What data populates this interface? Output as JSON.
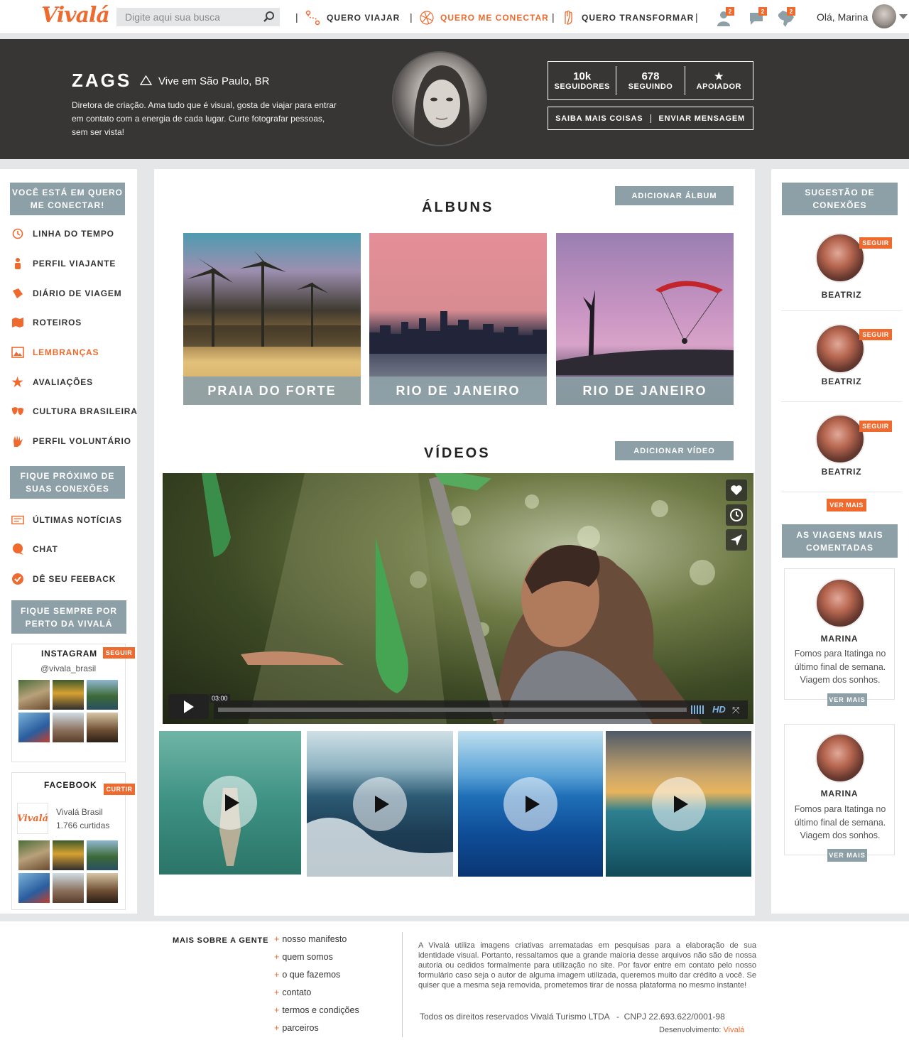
{
  "nav": {
    "logo": "Vivalá",
    "search_placeholder": "Digite aqui sua busca",
    "items": [
      {
        "label": "QUERO VIAJAR"
      },
      {
        "label": "QUERO ME CONECTAR"
      },
      {
        "label": "QUERO TRANSFORMAR"
      }
    ],
    "separator": "|",
    "badges": [
      "2",
      "2",
      "2"
    ],
    "greeting": "Olá, Marina"
  },
  "profile": {
    "name": "ZAGS",
    "location": "Vive em São Paulo, BR",
    "bio": "Diretora de criação. Ama tudo que é visual, gosta de viajar para entrar em contato com a energia de cada lugar. Curte fotografar pessoas, sem ser vista!",
    "stats": [
      {
        "value": "10k",
        "label": "SEGUIDORES"
      },
      {
        "value": "678",
        "label": "SEGUINDO"
      },
      {
        "value": "★",
        "label": "APOIADOR"
      }
    ],
    "actions": [
      "SAIBA MAIS COISAS",
      "ENVIAR MENSAGEM"
    ]
  },
  "left": {
    "box1": "VOCÊ ESTÁ EM QUERO ME CONECTAR!",
    "menu": [
      {
        "label": "LINHA DO TEMPO",
        "icon": "clock-icon"
      },
      {
        "label": "PERFIL VIAJANTE",
        "icon": "person-icon"
      },
      {
        "label": "DIÁRIO DE VIAGEM",
        "icon": "book-icon"
      },
      {
        "label": "ROTEIROS",
        "icon": "map-icon"
      },
      {
        "label": "LEMBRANÇAS",
        "icon": "photo-icon",
        "active": true
      },
      {
        "label": "AVALIAÇÕES",
        "icon": "star-icon"
      },
      {
        "label": "CULTURA BRASILEIRA",
        "icon": "masks-icon"
      },
      {
        "label": "PERFIL VOLUNTÁRIO",
        "icon": "hand-icon"
      }
    ],
    "box2": "FIQUE PRÓXIMO DE SUAS CONEXÕES",
    "menu2": [
      {
        "label": "ÚLTIMAS NOTÍCIAS",
        "icon": "news-icon"
      },
      {
        "label": "CHAT",
        "icon": "chat-icon"
      },
      {
        "label": "DÊ SEU FEEBACK",
        "icon": "check-icon"
      }
    ],
    "box3": "FIQUE SEMPRE POR PERTO DA VIVALÁ",
    "instagram": {
      "title": "INSTAGRAM",
      "tag": "SEGUIR",
      "handle": "@vivala_brasil"
    },
    "facebook": {
      "title": "FACEBOOK",
      "tag": "CURTIR",
      "page_logo": "Vivalá",
      "page_name": "Vivalá Brasil",
      "likes": "1.766 curtidas"
    }
  },
  "main": {
    "albums_title": "ÁLBUNS",
    "add_album": "ADICIONAR ÁLBUM",
    "albums": [
      {
        "caption": "PRAIA DO FORTE"
      },
      {
        "caption": "RIO DE JANEIRO"
      },
      {
        "caption": "RIO DE JANEIRO"
      }
    ],
    "videos_title": "VÍDEOS",
    "add_video": "ADICIONAR VÍDEO",
    "player": {
      "time": "03:00",
      "quality": "HD"
    }
  },
  "right": {
    "suggest_title": "SUGESTÃO DE CONEXÕES",
    "suggestions": [
      {
        "name": "BEATRIZ",
        "tag": "SEGUIR"
      },
      {
        "name": "BEATRIZ",
        "tag": "SEGUIR"
      },
      {
        "name": "BEATRIZ",
        "tag": "SEGUIR"
      }
    ],
    "see_more": "VER MAIS",
    "trips_title": "AS VIAGENS MAIS COMENTADAS",
    "trips": [
      {
        "name": "MARINA",
        "text": "Fomos para Itatinga no último final de semana. Viagem dos sonhos.",
        "more": "VER MAIS"
      },
      {
        "name": "MARINA",
        "text": "Fomos para Itatinga no último final de semana. Viagem dos sonhos.",
        "more": "VER MAIS"
      }
    ]
  },
  "footer": {
    "title": "MAIS SOBRE A GENTE",
    "links": [
      "nosso manifesto",
      "quem somos",
      "o que fazemos",
      "contato",
      "termos e condições",
      "parceiros"
    ],
    "disclaimer": "A Vivalá utiliza imagens criativas arrematadas em pesquisas para a elaboração de sua identidade visual. Portanto, ressaltamos que a grande maioria desse arquivos não são de nossa autoria ou cedidos formalmente para utilização no site. Por favor entre em contato pelo nosso formulário caso seja o autor de alguma imagem utilizada, queremos muito dar crédito a você. Se quiser que a mesma seja removida, prometemos tirar de nossa plataforma no mesmo instante!",
    "rights": "Todos os direitos reservados Vivalá Turismo LTDA   -  CNPJ 22.693.622/0001-98",
    "dev_label": "Desenvolvimento:",
    "dev_name": "Vivalá"
  },
  "colors": {
    "accent": "#ee6a2e",
    "slate": "#8ea0a7",
    "dark": "#373634"
  }
}
